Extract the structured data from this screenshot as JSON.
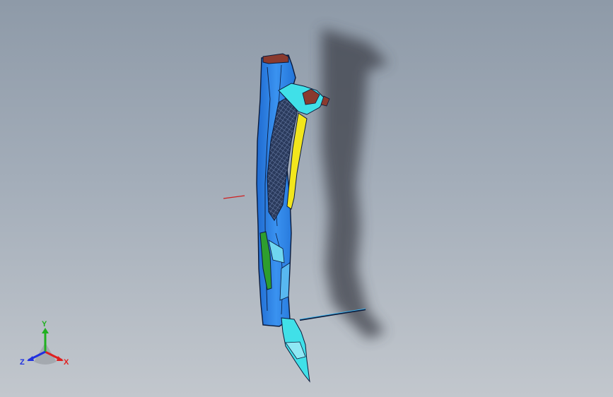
{
  "viewport": {
    "background_top": "#8e9aa8",
    "background_bottom": "#c2c7cd"
  },
  "model": {
    "body_color": "#2f86e8",
    "outline_color": "#0b1a3a",
    "accent_cyan": "#40e0e8",
    "accent_yellow": "#f2e61c",
    "accent_green": "#2e9e2e",
    "accent_brown": "#8a3a2e",
    "shadow_color": "#3c4048"
  },
  "triad": {
    "x_label": "X",
    "y_label": "Y",
    "z_label": "Z",
    "x_color": "#e02020",
    "y_color": "#20b020",
    "z_color": "#2030e0"
  }
}
